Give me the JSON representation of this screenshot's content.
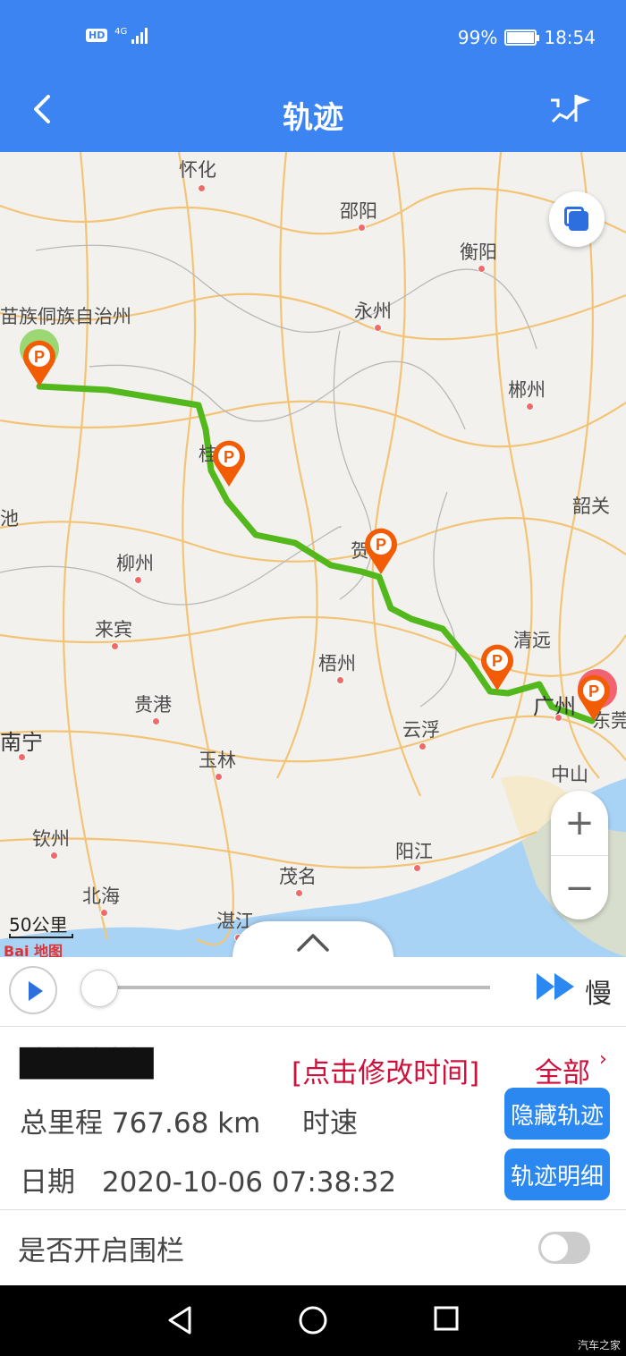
{
  "status_bar": {
    "network": "HD",
    "signal_type": "4G",
    "battery": "99%",
    "time": "18:54"
  },
  "header": {
    "title": "轨迹"
  },
  "map": {
    "cities": [
      {
        "name": "怀化",
        "big": false
      },
      {
        "name": "邵阳",
        "big": false
      },
      {
        "name": "衡阳",
        "big": false
      },
      {
        "name": "永州",
        "big": false
      },
      {
        "name": "郴州",
        "big": false
      },
      {
        "name": "苗族侗族自治州",
        "big": false
      },
      {
        "name": "韶关",
        "big": false
      },
      {
        "name": "贺",
        "big": false
      },
      {
        "name": "柳州",
        "big": false
      },
      {
        "name": "来宾",
        "big": false
      },
      {
        "name": "清远",
        "big": false
      },
      {
        "name": "梧州",
        "big": false
      },
      {
        "name": "广州",
        "big": true
      },
      {
        "name": "东莞",
        "big": false
      },
      {
        "name": "贵港",
        "big": false
      },
      {
        "name": "云浮",
        "big": false
      },
      {
        "name": "南宁",
        "big": true
      },
      {
        "name": "玉林",
        "big": false
      },
      {
        "name": "中山",
        "big": false
      },
      {
        "name": "钦州",
        "big": false
      },
      {
        "name": "阳江",
        "big": false
      },
      {
        "name": "茂名",
        "big": false
      },
      {
        "name": "北海",
        "big": false
      },
      {
        "name": "湛江",
        "big": false
      },
      {
        "name": "池",
        "big": false
      },
      {
        "name": "桂",
        "big": false
      }
    ],
    "scale_label": "50公里",
    "logo_text": "Bai 地图",
    "marker_label": "P",
    "route_color": "#52b81c",
    "marker_color": "#f25c05"
  },
  "player": {
    "speed_label": "慢"
  },
  "info": {
    "plate": "███████",
    "edit_time": "[点击修改时间]",
    "all_label": "全部",
    "all_arrow": "›",
    "mileage_label": "总里程",
    "mileage_value": "767.68 km",
    "speed_label": "时速",
    "date_label": "日期",
    "date_value": "2020-10-06 07:38:32",
    "hide_track_button": "隐藏轨迹",
    "track_detail_button": "轨迹明细"
  },
  "fence": {
    "label": "是否开启围栏",
    "enabled": false
  },
  "watermark": "汽车之家"
}
